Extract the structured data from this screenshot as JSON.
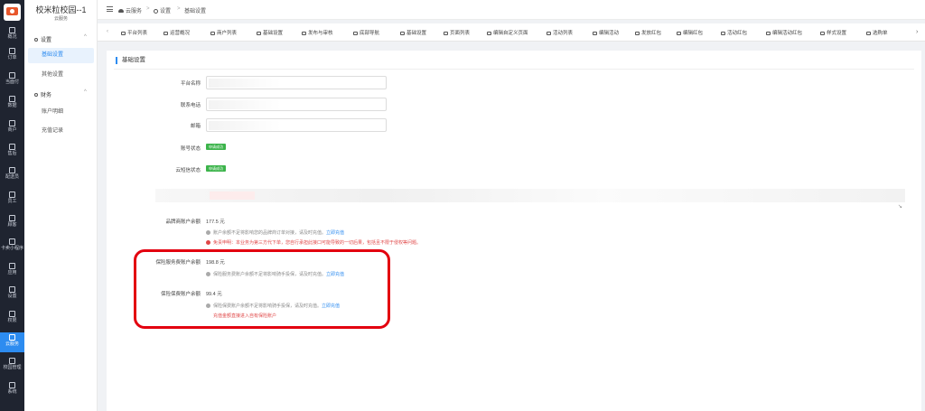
{
  "rail": {
    "items": [
      {
        "label": "概况",
        "icon": "grid-icon"
      },
      {
        "label": "订单",
        "icon": "list-icon"
      },
      {
        "label": "当面付",
        "icon": "pay-icon"
      },
      {
        "label": "数据",
        "icon": "chart-icon"
      },
      {
        "label": "商户",
        "icon": "store-icon"
      },
      {
        "label": "售后",
        "icon": "headset-icon"
      },
      {
        "label": "配送员",
        "icon": "courier-icon"
      },
      {
        "label": "员工",
        "icon": "staff-icon"
      },
      {
        "label": "顾客",
        "icon": "customer-icon"
      },
      {
        "label": "卡卖小程序",
        "icon": "miniapp-icon"
      },
      {
        "label": "应用",
        "icon": "apps-icon"
      },
      {
        "label": "设置",
        "icon": "settings-icon"
      },
      {
        "label": "权限",
        "icon": "lock-icon"
      },
      {
        "label": "云服务",
        "icon": "cloud-icon"
      },
      {
        "label": "校园管理",
        "icon": "campus-icon"
      },
      {
        "label": "系统",
        "icon": "system-icon"
      }
    ],
    "active_index": 13
  },
  "sidebar": {
    "title": "校米粒校园--1",
    "subtitle": "云服务",
    "group1": "设置",
    "group1_links": [
      "基础设置",
      "其他设置"
    ],
    "group2": "财务",
    "group2_links": [
      "账户明细",
      "充值记录"
    ]
  },
  "breadcrumb": {
    "items": [
      "云服务",
      "设置",
      "基础设置"
    ],
    "separator": ">"
  },
  "tabs": [
    "平台列表",
    "运营概况",
    "商户列表",
    "基础设置",
    "发布与审核",
    "底部导航",
    "基础设置",
    "页面列表",
    "编辑自定义页面",
    "活动列表",
    "编辑活动",
    "发放红包",
    "编辑红包",
    "活动红包",
    "编辑活动红包",
    "样式设置",
    "选购单"
  ],
  "panel": {
    "heading": "基础设置",
    "fields": {
      "platform_name_label": "平台名称",
      "phone_label": "联系电话",
      "email_label": "邮箱",
      "account_status_label": "账号状态",
      "account_status_value": "申请成功",
      "sms_status_label": "云短信状态",
      "sms_status_value": "申请成功"
    },
    "brand_balance": {
      "label": "品牌商账户余额",
      "value": "177.5 元",
      "note": "账户余额不足将影响您的品牌商订单对接，请及时充值。",
      "note_link": "立即充值",
      "warning": "免责申明：本业务为第三方代下单，您自行承担此接口可能导致的一切后果，包括且不限于侵权等问题。"
    },
    "insurance_service_balance": {
      "label": "保险服务费账户余额",
      "value": "198.8 元",
      "note": "保险服务费账户余额不足将影响骑手投保，请及时充值。",
      "note_link": "立即充值"
    },
    "insurance_premium_balance": {
      "label": "保险保费账户余额",
      "value": "99.4 元",
      "note": "保险保费账户余额不足将影响骑手投保，请及时充值。",
      "note_link": "立即充值",
      "red_note": "充值金额直接进入自有保险账户"
    }
  },
  "colors": {
    "accent": "#2d8cf0",
    "rail_bg": "#1f2430",
    "success": "#3cb44b",
    "danger": "#e04848",
    "highlight": "#e3000f"
  }
}
